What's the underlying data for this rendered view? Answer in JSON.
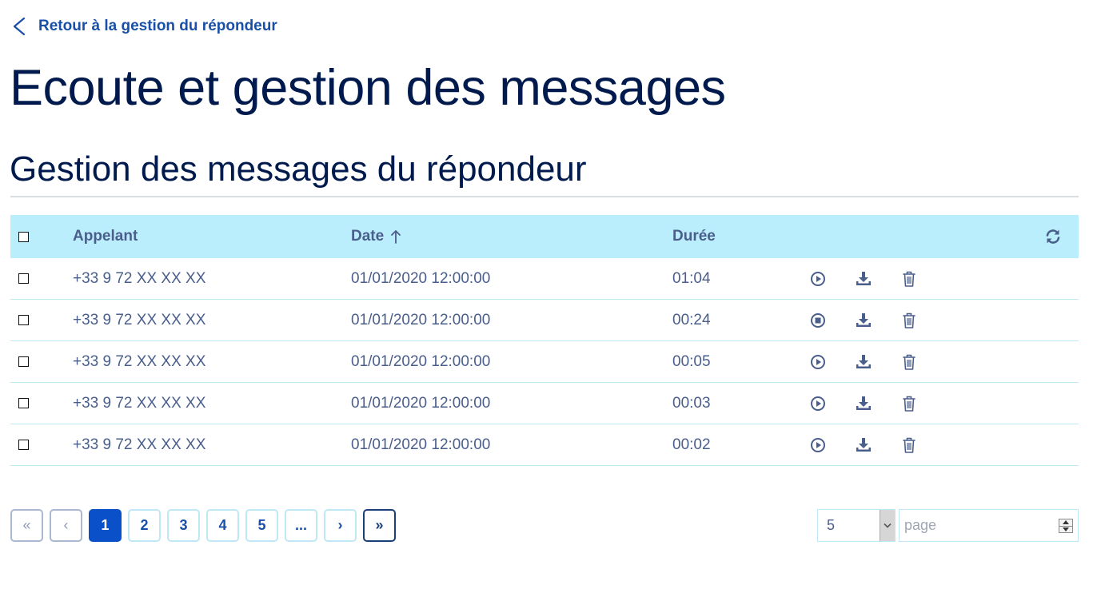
{
  "back_link": {
    "label": "Retour à la gestion du répondeur",
    "icon": "chevron-left-icon"
  },
  "page_title": "Ecoute et gestion des messages",
  "section_title": "Gestion des messages du répondeur",
  "table": {
    "headers": {
      "caller": "Appelant",
      "date": "Date",
      "duration": "Durée"
    },
    "sort": {
      "column": "date",
      "direction": "ascending",
      "icon": "arrow-up-icon"
    },
    "refresh_icon": "refresh-icon",
    "rows": [
      {
        "caller": "+33 9 72 XX XX XX",
        "date": "01/01/2020 12:00:00",
        "duration": "01:04",
        "playback": "play"
      },
      {
        "caller": "+33 9 72 XX XX XX",
        "date": "01/01/2020 12:00:00",
        "duration": "00:24",
        "playback": "stop"
      },
      {
        "caller": "+33 9 72 XX XX XX",
        "date": "01/01/2020 12:00:00",
        "duration": "00:05",
        "playback": "play"
      },
      {
        "caller": "+33 9 72 XX XX XX",
        "date": "01/01/2020 12:00:00",
        "duration": "00:03",
        "playback": "play"
      },
      {
        "caller": "+33 9 72 XX XX XX",
        "date": "01/01/2020 12:00:00",
        "duration": "00:02",
        "playback": "play"
      }
    ]
  },
  "pagination": {
    "first": "«",
    "prev": "‹",
    "pages": [
      "1",
      "2",
      "3",
      "4",
      "5"
    ],
    "current_page": "1",
    "ellipsis": "...",
    "next": "›",
    "last": "»"
  },
  "per_page": {
    "value": "5"
  },
  "page_input": {
    "placeholder": "page"
  },
  "colors": {
    "title": "#001a4d",
    "link": "#1a4fa8",
    "header_bg": "#bbeefc",
    "text": "#4a5e8c",
    "active_page": "#0a50c8"
  }
}
